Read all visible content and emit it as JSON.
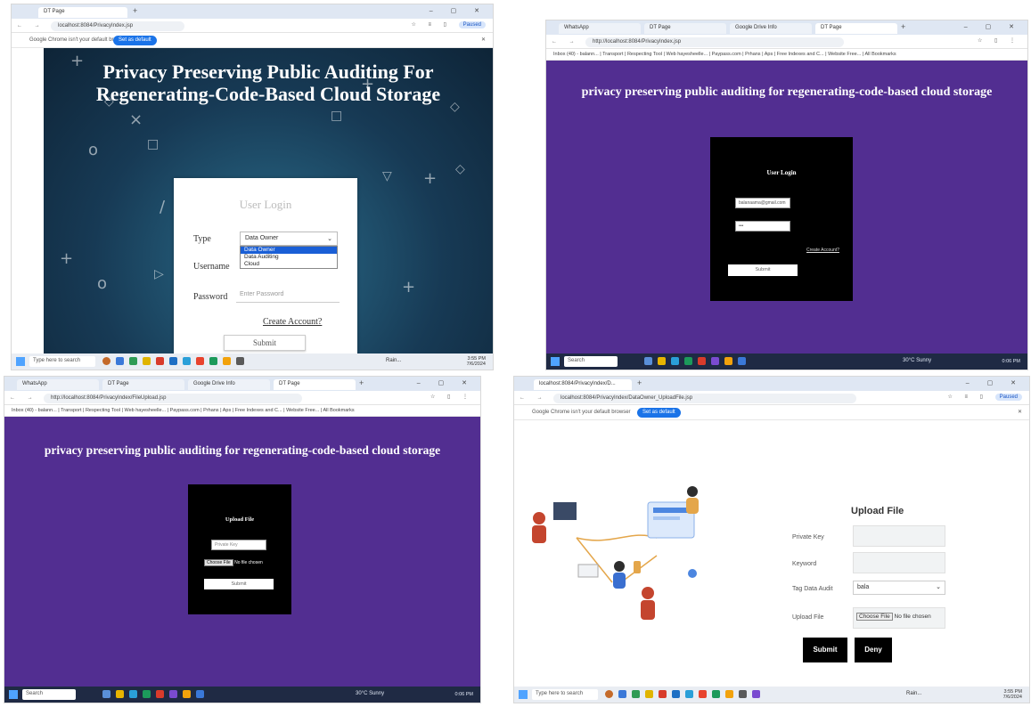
{
  "panel1": {
    "tabs": [
      {
        "label": "DT Page"
      }
    ],
    "address": "localhost:8084/PrivacyIndex.jsp",
    "infobar": {
      "message": "Google Chrome isn't your default browser",
      "button": "Set as default"
    },
    "title_line1": "Privacy Preserving Public Auditing For",
    "title_line2": "Regenerating-Code-Based Cloud Storage",
    "card": {
      "title": "User Login",
      "type_label": "Type",
      "type_value": "Data Owner",
      "options": [
        "Data Owner",
        "Data Auditing",
        "Cloud"
      ],
      "username_label": "Username",
      "password_label": "Password",
      "password_placeholder": "Enter Password",
      "create_account": "Create Account?",
      "submit": "Submit"
    },
    "taskbar": {
      "search": "Type here to search",
      "weather": "Rain...",
      "time": "3:55 PM",
      "date": "7/6/2024"
    }
  },
  "panel2": {
    "tabs": [
      {
        "label": "WhatsApp"
      },
      {
        "label": "DT Page"
      },
      {
        "label": "Google Drive Info"
      },
      {
        "label": "DT Page"
      }
    ],
    "address": "http://localhost:8084/PrivacyIndex.jsp",
    "bookmarks": "Inbox (40) - balann... | Transport | Respecting Tool | Web hayesheelle... | Paypass.com | Prhans | Aps | Free Indexes and C... | Website Free... | All Bookmarks",
    "title": "privacy preserving public auditing for regenerating-code-based cloud storage",
    "box": {
      "title": "User Login",
      "email_value": "balanaama@gmail.com",
      "password_value": "•••",
      "link": "Create Account?",
      "submit": "Submit"
    },
    "taskbar": {
      "search": "Search",
      "weather": "30°C Sunny",
      "time": "0:06 PM"
    }
  },
  "panel3": {
    "tabs": [
      {
        "label": "WhatsApp"
      },
      {
        "label": "DT Page"
      },
      {
        "label": "Google Drive Info"
      },
      {
        "label": "DT Page"
      }
    ],
    "address": "http://localhost:8084/PrivacyIndex/FileUpload.jsp",
    "bookmarks": "Inbox (40) - balann... | Transport | Respecting Tool | Web hayesheelle... | Paypass.com | Prhans | Aps | Free Indexes and C... | Website Free... | All Bookmarks",
    "title": "privacy preserving public auditing for regenerating-code-based cloud storage",
    "box": {
      "title": "Upload File",
      "key_placeholder": "Private Key",
      "choose": "Choose File",
      "no_file": "No file chosen",
      "submit": "Submit"
    },
    "taskbar": {
      "search": "Search",
      "weather": "30°C Sunny",
      "time": "0:06 PM"
    }
  },
  "panel4": {
    "tabs": [
      {
        "label": "localhost:8084/PrivacyIndex/D..."
      }
    ],
    "address": "localhost:8084/PrivacyIndex/DataOwner_UploadFile.jsp",
    "infobar": {
      "message": "Google Chrome isn't your default browser",
      "button": "Set as default"
    },
    "form": {
      "title": "Upload File",
      "private_key_label": "Private Key",
      "keyword_label": "Keyword",
      "tag_label": "Tag Data Audit",
      "tag_value": "bala",
      "upload_label": "Upload File",
      "choose": "Choose File",
      "no_file": "No file chosen",
      "submit": "Submit",
      "deny": "Deny"
    },
    "taskbar": {
      "search": "Type here to search",
      "weather": "Rain...",
      "time": "3:55 PM",
      "date": "7/6/2024"
    }
  },
  "colors": {
    "purple": "#522e91",
    "navy": "#173a55",
    "chrome_blue": "#1a73e8"
  }
}
